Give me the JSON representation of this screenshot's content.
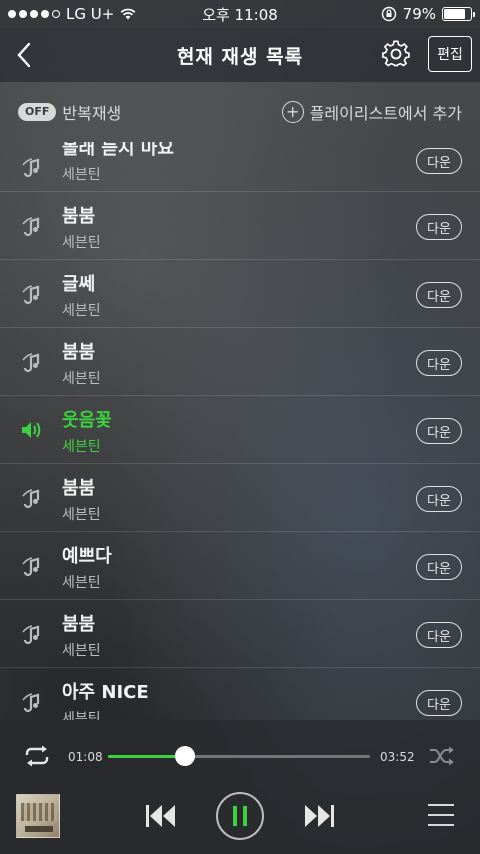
{
  "status_bar": {
    "carrier": "LG U+",
    "time": "오후 11:08",
    "battery": "79%",
    "battery_level": 0.79
  },
  "header": {
    "title": "현재 재생 목록",
    "edit_label": "편집"
  },
  "options": {
    "repeat_toggle": "OFF",
    "repeat_label": "반복재생",
    "add_from_playlist": "플레이리스트에서 추가"
  },
  "tracks": [
    {
      "title": "볼래 듣지 마요",
      "artist": "세븐틴",
      "down": "다운"
    },
    {
      "title": "붐붐",
      "artist": "세븐틴",
      "down": "다운"
    },
    {
      "title": "글쎄",
      "artist": "세븐틴",
      "down": "다운"
    },
    {
      "title": "붐붐",
      "artist": "세븐틴",
      "down": "다운"
    },
    {
      "title": "웃음꽃",
      "artist": "세븐틴",
      "down": "다운",
      "active": true
    },
    {
      "title": "붐붐",
      "artist": "세븐틴",
      "down": "다운"
    },
    {
      "title": "예쁘다",
      "artist": "세븐틴",
      "down": "다운"
    },
    {
      "title": "붐붐",
      "artist": "세븐틴",
      "down": "다운"
    },
    {
      "title": "아주 NICE",
      "artist": "세븐틴",
      "down": "다운"
    }
  ],
  "player": {
    "current_time": "01:08",
    "total_time": "03:52",
    "progress": 0.293
  },
  "colors": {
    "accent": "#3ed13e"
  }
}
